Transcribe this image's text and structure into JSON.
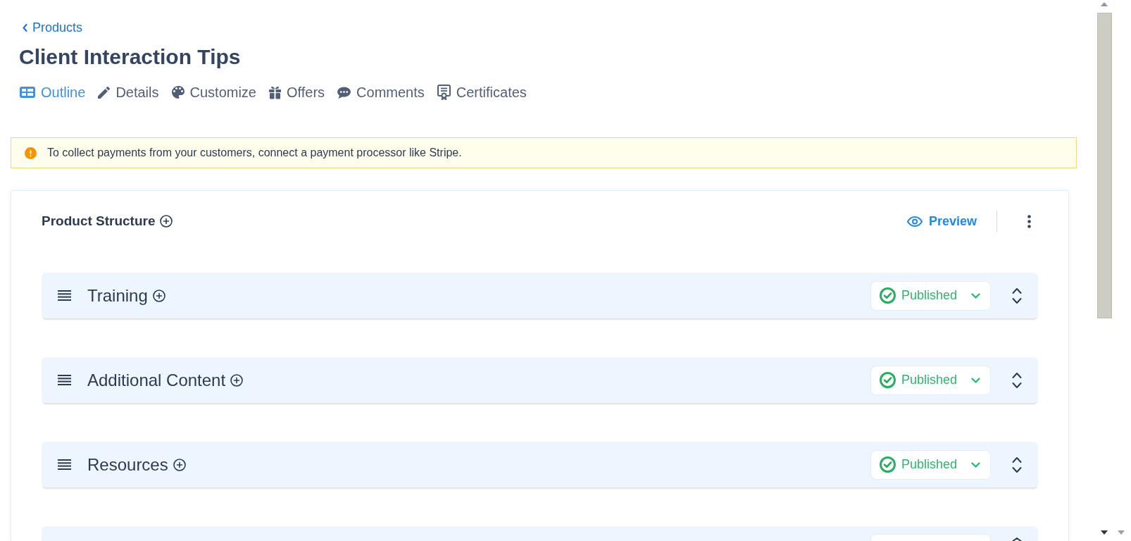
{
  "back_link": {
    "label": "Products"
  },
  "page_title": "Client Interaction Tips",
  "tabs": [
    {
      "label": "Outline",
      "selected": true
    },
    {
      "label": "Details",
      "selected": false
    },
    {
      "label": "Customize",
      "selected": false
    },
    {
      "label": "Offers",
      "selected": false
    },
    {
      "label": "Comments",
      "selected": false
    },
    {
      "label": "Certificates",
      "selected": false
    }
  ],
  "alert": {
    "message": "To collect payments from your customers, connect a payment processor like Stripe."
  },
  "product_structure": {
    "title": "Product Structure",
    "preview_button": "Preview",
    "sections": [
      {
        "kind": "section",
        "title": "Training",
        "status": "Published"
      },
      {
        "kind": "section",
        "title": "Additional Content",
        "status": "Published"
      },
      {
        "kind": "section",
        "title": "Resources",
        "status": "Published"
      },
      {
        "kind": "cut_off"
      }
    ]
  }
}
